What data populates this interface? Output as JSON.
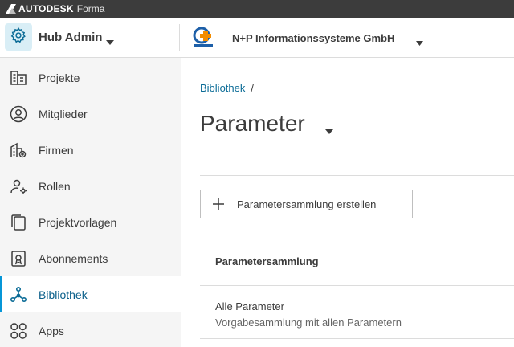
{
  "brand": {
    "name": "AUTODESK",
    "product": "Forma"
  },
  "header": {
    "hub_name": "Hub Admin",
    "company_name": "N+P Informationssysteme GmbH",
    "company_logo_text": "N+P"
  },
  "sidebar": {
    "items": [
      {
        "label": "Projekte",
        "icon": "building-icon"
      },
      {
        "label": "Mitglieder",
        "icon": "user-circle-icon"
      },
      {
        "label": "Firmen",
        "icon": "company-icon"
      },
      {
        "label": "Rollen",
        "icon": "user-gear-icon"
      },
      {
        "label": "Projektvorlagen",
        "icon": "template-icon"
      },
      {
        "label": "Abonnements",
        "icon": "subscription-icon"
      },
      {
        "label": "Bibliothek",
        "icon": "library-icon",
        "active": true
      },
      {
        "label": "Apps",
        "icon": "apps-icon"
      }
    ]
  },
  "main": {
    "breadcrumb": {
      "link": "Bibliothek",
      "separator": "/"
    },
    "title": "Parameter",
    "create_button": "Parametersammlung erstellen",
    "table": {
      "column_header": "Parametersammlung",
      "rows": [
        {
          "title": "Alle Parameter",
          "description": "Vorgabesammlung mit allen Parametern"
        }
      ]
    }
  },
  "colors": {
    "brand_bar": "#3c3c3c",
    "sidebar_bg": "#f5f5f5",
    "accent": "#0696d7",
    "link": "#0a6b96",
    "hub_icon_bg": "#d9eef6"
  }
}
